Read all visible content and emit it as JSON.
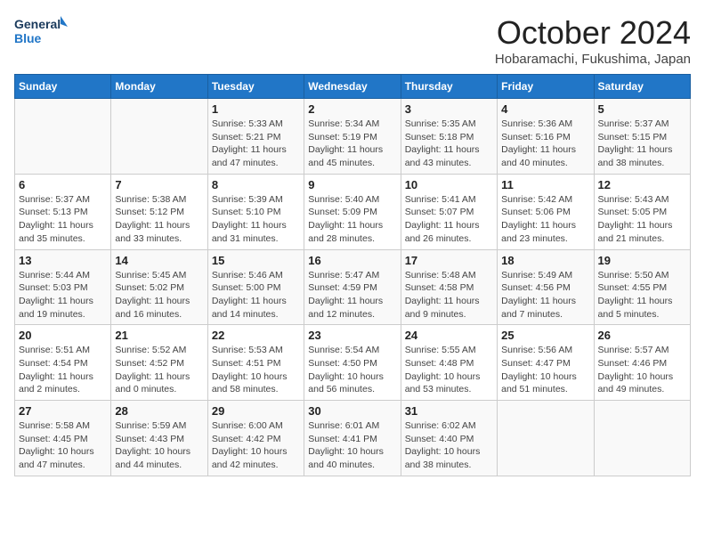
{
  "logo": {
    "general": "General",
    "blue": "Blue"
  },
  "title": "October 2024",
  "subtitle": "Hobaramachi, Fukushima, Japan",
  "days_of_week": [
    "Sunday",
    "Monday",
    "Tuesday",
    "Wednesday",
    "Thursday",
    "Friday",
    "Saturday"
  ],
  "weeks": [
    [
      {
        "day": "",
        "info": ""
      },
      {
        "day": "",
        "info": ""
      },
      {
        "day": "1",
        "info": "Sunrise: 5:33 AM\nSunset: 5:21 PM\nDaylight: 11 hours and 47 minutes."
      },
      {
        "day": "2",
        "info": "Sunrise: 5:34 AM\nSunset: 5:19 PM\nDaylight: 11 hours and 45 minutes."
      },
      {
        "day": "3",
        "info": "Sunrise: 5:35 AM\nSunset: 5:18 PM\nDaylight: 11 hours and 43 minutes."
      },
      {
        "day": "4",
        "info": "Sunrise: 5:36 AM\nSunset: 5:16 PM\nDaylight: 11 hours and 40 minutes."
      },
      {
        "day": "5",
        "info": "Sunrise: 5:37 AM\nSunset: 5:15 PM\nDaylight: 11 hours and 38 minutes."
      }
    ],
    [
      {
        "day": "6",
        "info": "Sunrise: 5:37 AM\nSunset: 5:13 PM\nDaylight: 11 hours and 35 minutes."
      },
      {
        "day": "7",
        "info": "Sunrise: 5:38 AM\nSunset: 5:12 PM\nDaylight: 11 hours and 33 minutes."
      },
      {
        "day": "8",
        "info": "Sunrise: 5:39 AM\nSunset: 5:10 PM\nDaylight: 11 hours and 31 minutes."
      },
      {
        "day": "9",
        "info": "Sunrise: 5:40 AM\nSunset: 5:09 PM\nDaylight: 11 hours and 28 minutes."
      },
      {
        "day": "10",
        "info": "Sunrise: 5:41 AM\nSunset: 5:07 PM\nDaylight: 11 hours and 26 minutes."
      },
      {
        "day": "11",
        "info": "Sunrise: 5:42 AM\nSunset: 5:06 PM\nDaylight: 11 hours and 23 minutes."
      },
      {
        "day": "12",
        "info": "Sunrise: 5:43 AM\nSunset: 5:05 PM\nDaylight: 11 hours and 21 minutes."
      }
    ],
    [
      {
        "day": "13",
        "info": "Sunrise: 5:44 AM\nSunset: 5:03 PM\nDaylight: 11 hours and 19 minutes."
      },
      {
        "day": "14",
        "info": "Sunrise: 5:45 AM\nSunset: 5:02 PM\nDaylight: 11 hours and 16 minutes."
      },
      {
        "day": "15",
        "info": "Sunrise: 5:46 AM\nSunset: 5:00 PM\nDaylight: 11 hours and 14 minutes."
      },
      {
        "day": "16",
        "info": "Sunrise: 5:47 AM\nSunset: 4:59 PM\nDaylight: 11 hours and 12 minutes."
      },
      {
        "day": "17",
        "info": "Sunrise: 5:48 AM\nSunset: 4:58 PM\nDaylight: 11 hours and 9 minutes."
      },
      {
        "day": "18",
        "info": "Sunrise: 5:49 AM\nSunset: 4:56 PM\nDaylight: 11 hours and 7 minutes."
      },
      {
        "day": "19",
        "info": "Sunrise: 5:50 AM\nSunset: 4:55 PM\nDaylight: 11 hours and 5 minutes."
      }
    ],
    [
      {
        "day": "20",
        "info": "Sunrise: 5:51 AM\nSunset: 4:54 PM\nDaylight: 11 hours and 2 minutes."
      },
      {
        "day": "21",
        "info": "Sunrise: 5:52 AM\nSunset: 4:52 PM\nDaylight: 11 hours and 0 minutes."
      },
      {
        "day": "22",
        "info": "Sunrise: 5:53 AM\nSunset: 4:51 PM\nDaylight: 10 hours and 58 minutes."
      },
      {
        "day": "23",
        "info": "Sunrise: 5:54 AM\nSunset: 4:50 PM\nDaylight: 10 hours and 56 minutes."
      },
      {
        "day": "24",
        "info": "Sunrise: 5:55 AM\nSunset: 4:48 PM\nDaylight: 10 hours and 53 minutes."
      },
      {
        "day": "25",
        "info": "Sunrise: 5:56 AM\nSunset: 4:47 PM\nDaylight: 10 hours and 51 minutes."
      },
      {
        "day": "26",
        "info": "Sunrise: 5:57 AM\nSunset: 4:46 PM\nDaylight: 10 hours and 49 minutes."
      }
    ],
    [
      {
        "day": "27",
        "info": "Sunrise: 5:58 AM\nSunset: 4:45 PM\nDaylight: 10 hours and 47 minutes."
      },
      {
        "day": "28",
        "info": "Sunrise: 5:59 AM\nSunset: 4:43 PM\nDaylight: 10 hours and 44 minutes."
      },
      {
        "day": "29",
        "info": "Sunrise: 6:00 AM\nSunset: 4:42 PM\nDaylight: 10 hours and 42 minutes."
      },
      {
        "day": "30",
        "info": "Sunrise: 6:01 AM\nSunset: 4:41 PM\nDaylight: 10 hours and 40 minutes."
      },
      {
        "day": "31",
        "info": "Sunrise: 6:02 AM\nSunset: 4:40 PM\nDaylight: 10 hours and 38 minutes."
      },
      {
        "day": "",
        "info": ""
      },
      {
        "day": "",
        "info": ""
      }
    ]
  ]
}
